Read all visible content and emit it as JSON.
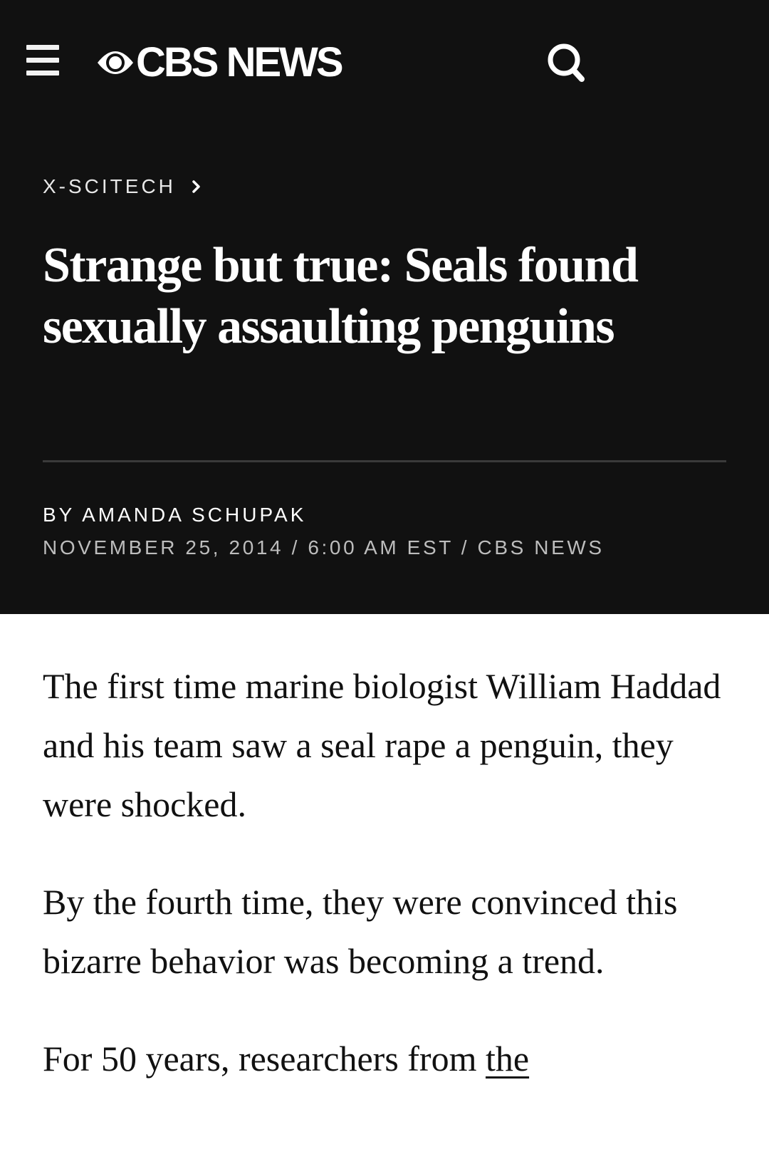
{
  "nav": {
    "logo_text": "CBS NEWS",
    "menu_icon": "hamburger-menu-icon",
    "search_icon": "search-icon",
    "logo_icon": "cbs-eye-logo-icon"
  },
  "colors": {
    "header_bg": "#111111",
    "text_light": "#ffffff",
    "text_muted": "#bdbdbd",
    "body_text": "#111111"
  },
  "article": {
    "section": "X-SCITECH",
    "headline": "Strange but true: Seals found sexually assaulting penguins",
    "byline": "BY AMANDA SCHUPAK",
    "dateline": "NOVEMBER 25, 2014 / 6:00 AM EST / CBS NEWS",
    "paragraphs": [
      "The first time marine biologist William Haddad and his team saw a seal rape a penguin, they were shocked.",
      "By the fourth time, they were convinced this bizarre behavior was becoming a trend."
    ],
    "paragraph3_prefix": "For 50 years, researchers from ",
    "paragraph3_link": "the"
  }
}
